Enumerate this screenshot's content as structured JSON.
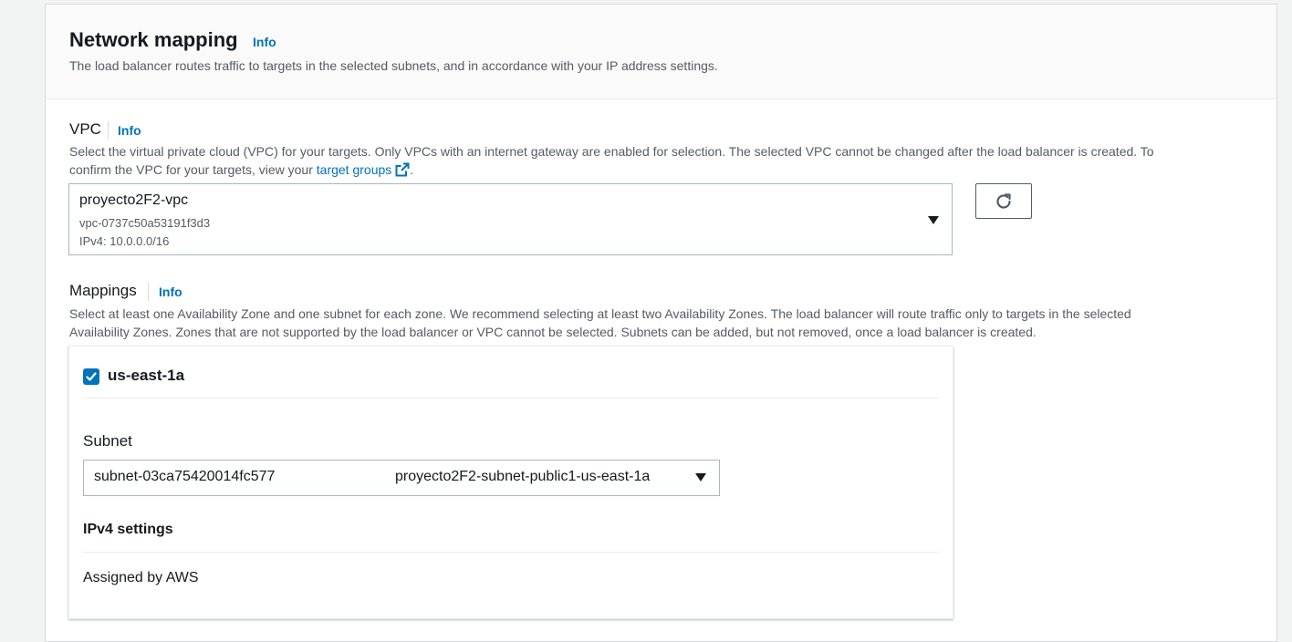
{
  "section": {
    "title": "Network mapping",
    "info_label": "Info",
    "description": "The load balancer routes traffic to targets in the selected subnets, and in accordance with your IP address settings."
  },
  "vpc": {
    "label": "VPC",
    "info_label": "Info",
    "description_line1": "Select the virtual private cloud (VPC) for your targets. Only VPCs with an internet gateway are enabled for selection. The selected VPC cannot be changed after the load balancer is created. To",
    "description_line2_prefix": "confirm the VPC for your targets, view your ",
    "link_text": "target groups",
    "description_line2_suffix": ".",
    "selected": {
      "name": "proyecto2F2-vpc",
      "id": "vpc-0737c50a53191f3d3",
      "cidr": "IPv4: 10.0.0.0/16"
    },
    "refresh_icon": "refresh-icon"
  },
  "mappings": {
    "label": "Mappings",
    "info_label": "Info",
    "description_line1": "Select at least one Availability Zone and one subnet for each zone. We recommend selecting at least two Availability Zones. The load balancer will route traffic only to targets in the selected",
    "description_line2": "Availability Zones. Zones that are not supported by the load balancer or VPC cannot be selected. Subnets can be added, but not removed, once a load balancer is created.",
    "zones": [
      {
        "name": "us-east-1a",
        "checked": true,
        "subnet_label": "Subnet",
        "subnet_id": "subnet-03ca75420014fc577",
        "subnet_name": "proyecto2F2-subnet-public1-us-east-1a",
        "ipv4_title": "IPv4 settings",
        "ipv4_value": "Assigned by AWS"
      }
    ]
  },
  "colors": {
    "link": "#0073bb",
    "text": "#16191f",
    "secondary_text": "#545b64",
    "border": "#aab7b8",
    "background": "#f2f3f3"
  }
}
